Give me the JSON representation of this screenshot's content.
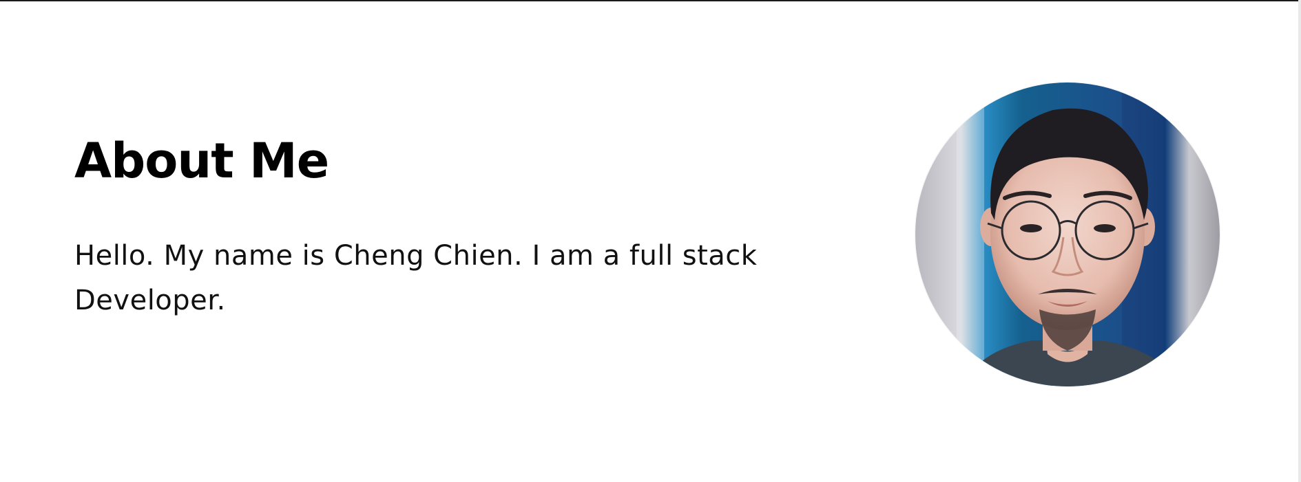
{
  "about": {
    "title": "About Me",
    "description": "Hello. My name is Cheng Chien. I am a full stack Developer."
  },
  "colors": {
    "background": "#ffffff",
    "text": "#000000",
    "border": "#1a1a1a"
  }
}
